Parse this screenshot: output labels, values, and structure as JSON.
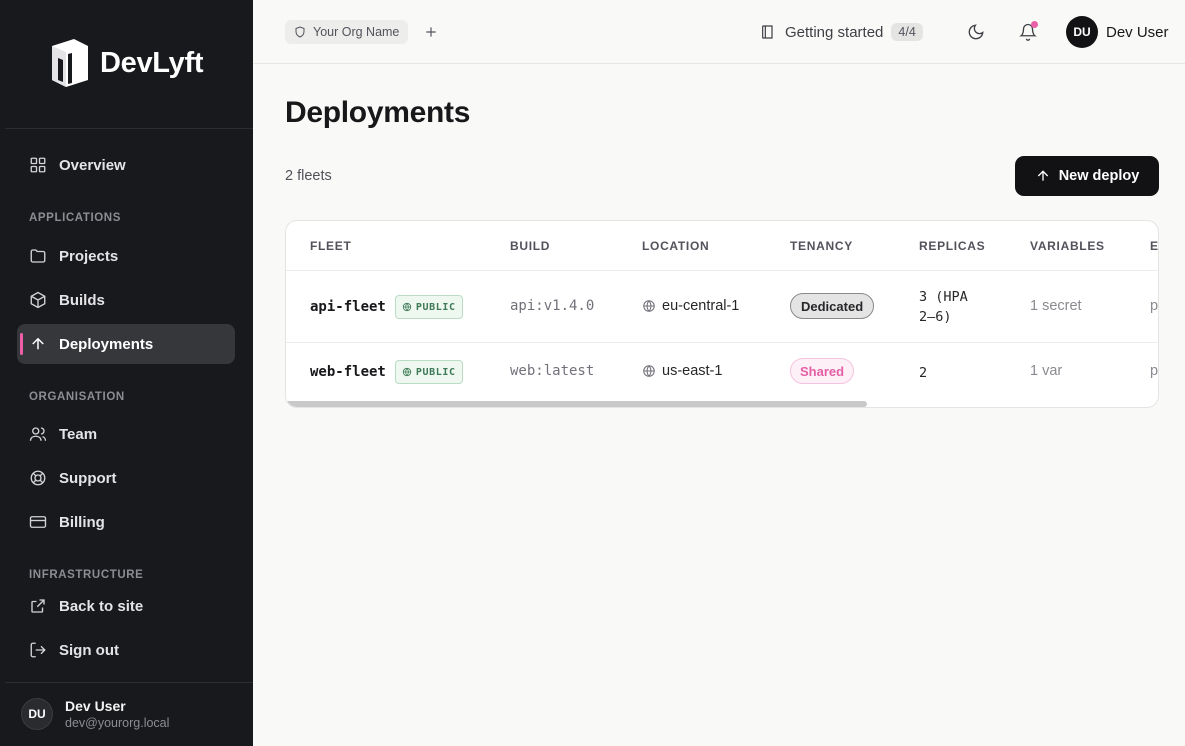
{
  "brand": {
    "name": "DevLyft"
  },
  "sidebar": {
    "overview": "Overview",
    "sections": {
      "applications": "APPLICATIONS",
      "organisation": "ORGANISATION",
      "infrastructure": "INFRASTRUCTURE"
    },
    "projects": "Projects",
    "builds": "Builds",
    "deployments": "Deployments",
    "team": "Team",
    "support": "Support",
    "billing": "Billing",
    "back_to_site": "Back to site",
    "sign_out": "Sign out",
    "user": {
      "initials": "DU",
      "name": "Dev User",
      "email": "dev@yourorg.local"
    }
  },
  "topbar": {
    "org_name": "Your Org Name",
    "getting_started": "Getting started",
    "progress": "4/4",
    "user": {
      "initials": "DU",
      "name": "Dev User"
    }
  },
  "main": {
    "title": "Deployments",
    "count": "2 fleets",
    "new_deploy": "New deploy",
    "table": {
      "headers": {
        "fleet": "FLEET",
        "build": "BUILD",
        "location": "LOCATION",
        "tenancy": "TENANCY",
        "replicas": "REPLICAS",
        "variables": "VARIABLES",
        "clipped": "E"
      },
      "rows": [
        {
          "fleet": "api-fleet",
          "badge": "PUBLIC",
          "build": "api:v1.4.0",
          "location": "eu-central-1",
          "tenancy": "Dedicated",
          "replicas": "3 (HPA 2–6)",
          "variables": "1 secret",
          "clipped": "p"
        },
        {
          "fleet": "web-fleet",
          "badge": "PUBLIC",
          "build": "web:latest",
          "location": "us-east-1",
          "tenancy": "Shared",
          "replicas": "2",
          "variables": "1 var",
          "clipped": "p"
        }
      ]
    }
  },
  "colors": {
    "accent": "#ec5fa8",
    "sidebar_bg": "#18191c",
    "public_green": "#3d7a55"
  }
}
